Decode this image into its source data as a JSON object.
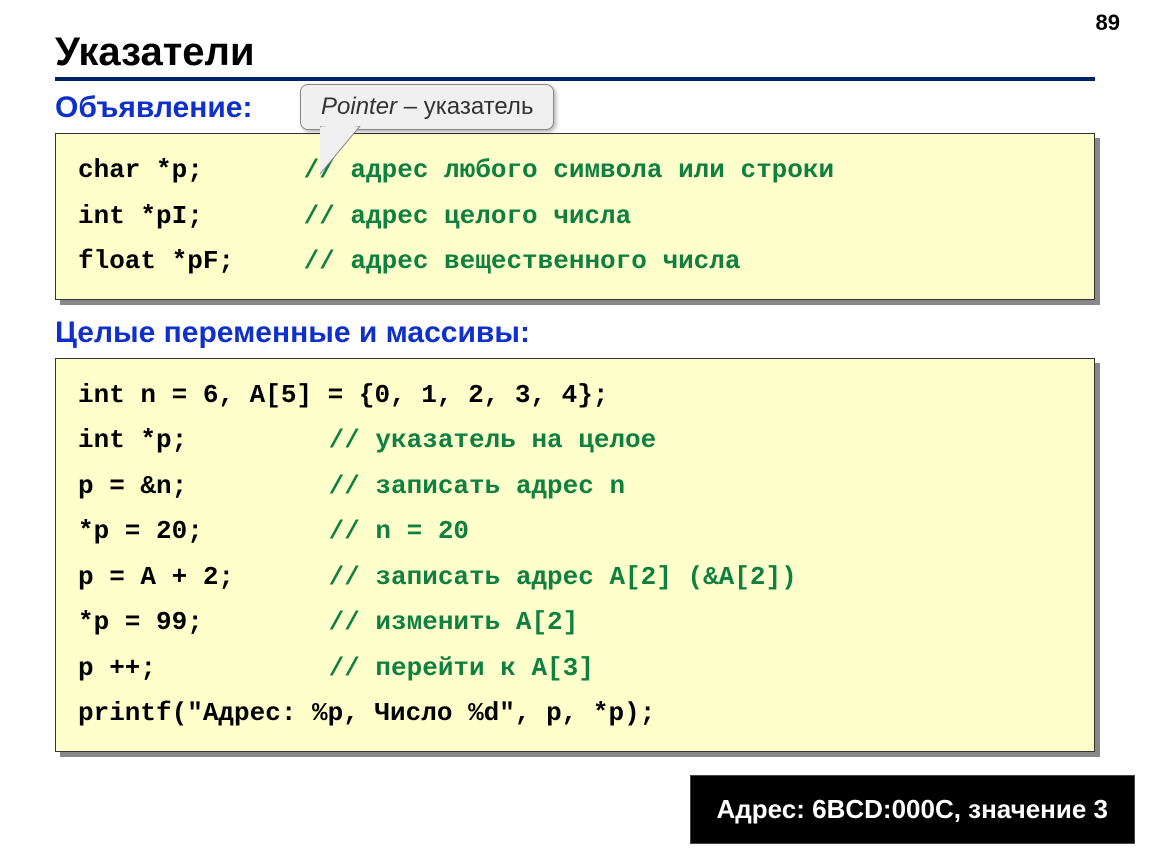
{
  "page_number": "89",
  "title": "Указатели",
  "callout_html": "<em>Pointer</em> – указатель",
  "subtitle1": "Объявление:",
  "block1": {
    "l1_code": "char *p;",
    "l1_cmt": "// адрес любого символа или строки",
    "l2_code": "int *pI;",
    "l2_cmt": "// адрес целого числа",
    "l3_code": "float *pF;",
    "l3_cmt": "// адрес вещественного числа"
  },
  "subtitle2": "Целые переменные и массивы:",
  "block2": {
    "l1": "int n = 6, A[5] = {0, 1, 2, 3, 4};",
    "l2_code": "int *p;",
    "l2_cmt": "// указатель на целое",
    "l3_code": "p = &n;",
    "l3_cmt": "// записать адрес n",
    "l4_code": "*p = 20;",
    "l4_cmt": "// n = 20",
    "l5_code": "p = A + 2;",
    "l5_cmt": "// записать адрес A[2] (&A[2])",
    "l6_code": "*p = 99;",
    "l6_cmt": "// изменить A[2]",
    "l7_code": "p ++;",
    "l7_cmt": "// перейти к A[3]",
    "l8": "printf(\"Адрес: %p, Число %d\", p, *p);"
  },
  "output_box": "Адрес: 6BCD:000C, значение 3"
}
